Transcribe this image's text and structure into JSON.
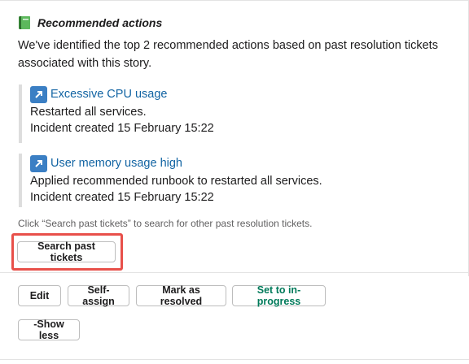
{
  "header": {
    "icon": "green-book-icon",
    "title": "Recommended actions"
  },
  "intro": "We've identified the top 2 recommended actions based on past resolution tickets associated with this story.",
  "actions": [
    {
      "icon": "arrow-up-right-icon",
      "title": "Excessive CPU usage",
      "detail": "Restarted all services.",
      "incident": "Incident created 15 February 15:22"
    },
    {
      "icon": "arrow-up-right-icon",
      "title": "User memory usage high",
      "detail": "Applied recommended runbook to restarted all services.",
      "incident": "Incident created 15 February 15:22"
    }
  ],
  "hint": "Click “Search past tickets” to search for other past resolution tickets.",
  "buttons": {
    "search": "Search past tickets",
    "edit": "Edit",
    "self_assign": "Self-assign",
    "mark_resolved": "Mark as resolved",
    "in_progress": "Set to in-progress",
    "show_less": "-Show less"
  },
  "colors": {
    "link": "#1264a3",
    "highlight": "#e8504a",
    "in_progress_text": "#007a5a",
    "arrow_icon_bg": "#3b7fc4",
    "book_icon": "#2eb67d"
  }
}
